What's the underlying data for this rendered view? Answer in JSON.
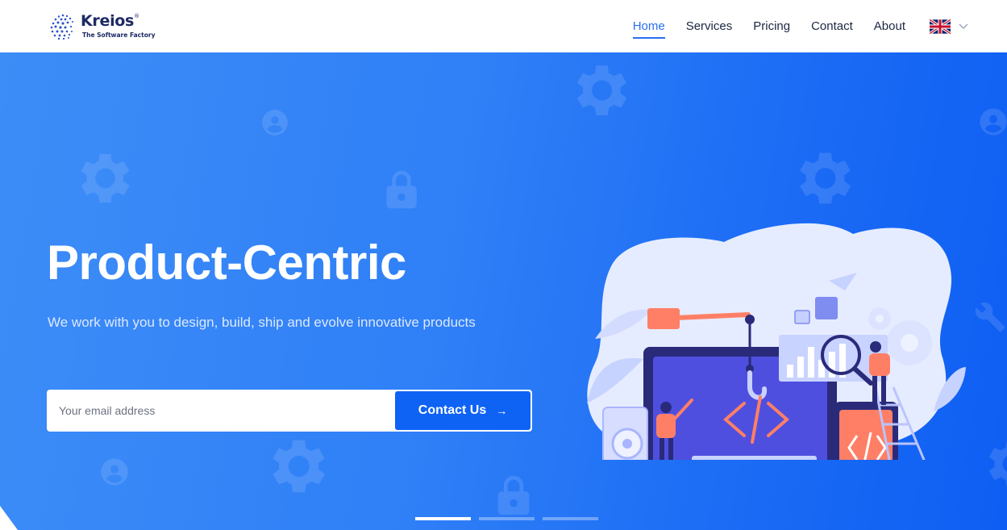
{
  "brand": {
    "name": "Kreios",
    "tagline": "The Software Factory",
    "registered_mark": "®"
  },
  "nav": {
    "items": [
      {
        "label": "Home",
        "active": true
      },
      {
        "label": "Services",
        "active": false
      },
      {
        "label": "Pricing",
        "active": false
      },
      {
        "label": "Contact",
        "active": false
      },
      {
        "label": "About",
        "active": false
      }
    ],
    "language": {
      "icon": "uk-flag-icon",
      "dropdown_icon": "chevron-down-icon"
    }
  },
  "hero": {
    "title": "Product-Centric",
    "subtitle": "We work with you to design, build, ship and evolve innovative products",
    "email_placeholder": "Your email address",
    "email_value": "",
    "cta_label": "Contact Us",
    "cta_icon": "arrow-right-icon",
    "slides_total": 3,
    "active_slide": 1
  },
  "colors": {
    "primary": "#0e63f4",
    "accent_link": "#2b6ef0",
    "navy": "#1d2a63",
    "hero_gradient_start": "#3d8df7",
    "hero_gradient_end": "#0e5ef3"
  }
}
